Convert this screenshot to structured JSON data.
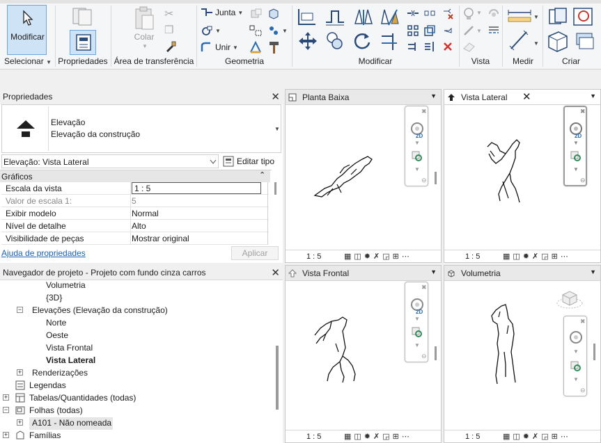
{
  "ribbon": {
    "selecionar": {
      "button_label": "Modificar",
      "group_label": "Selecionar"
    },
    "propriedades": {
      "group_label": "Propriedades"
    },
    "clipboard": {
      "colar_label": "Colar",
      "group_label": "Área de transferência"
    },
    "geometria": {
      "junta_label": "Junta",
      "unir_label": "Unir",
      "group_label": "Geometria"
    },
    "modificar": {
      "group_label": "Modificar"
    },
    "vista": {
      "group_label": "Vista"
    },
    "medir": {
      "group_label": "Medir"
    },
    "criar": {
      "group_label": "Criar"
    }
  },
  "properties": {
    "title": "Propriedades",
    "type_line1": "Elevação",
    "type_line2": "Elevação da construção",
    "selector_value": "Elevação: Vista Lateral",
    "edit_type_label": "Editar tipo",
    "section_label": "Gráficos",
    "rows": [
      {
        "key": "Escala da vista",
        "value": "1 : 5"
      },
      {
        "key": "Valor de escala    1:",
        "value": "5"
      },
      {
        "key": "Exibir modelo",
        "value": "Normal"
      },
      {
        "key": "Nível de detalhe",
        "value": "Alto"
      },
      {
        "key": "Visibilidade de peças",
        "value": "Mostrar original"
      }
    ],
    "help_link": "Ajuda de propriedades",
    "apply_label": "Aplicar"
  },
  "browser": {
    "title": "Navegador de projeto - Projeto com fundo cinza carros",
    "items": [
      {
        "label": "Volumetria"
      },
      {
        "label": "{3D}"
      },
      {
        "label": "Elevações (Elevação da construção)"
      },
      {
        "label": "Norte"
      },
      {
        "label": "Oeste"
      },
      {
        "label": "Vista Frontal"
      },
      {
        "label": "Vista Lateral"
      },
      {
        "label": "Renderizações"
      },
      {
        "label": "Legendas"
      },
      {
        "label": "Tabelas/Quantidades (todas)"
      },
      {
        "label": "Folhas (todas)"
      },
      {
        "label": "A101 - Não nomeada"
      },
      {
        "label": "Famílias"
      }
    ]
  },
  "views": [
    {
      "title": "Planta Baixa",
      "scale": "1 : 5"
    },
    {
      "title": "Vista Lateral",
      "scale": "1 : 5"
    },
    {
      "title": "Vista Frontal",
      "scale": "1 : 5"
    },
    {
      "title": "Volumetria",
      "scale": "1 : 5"
    }
  ],
  "nav_badge": "2D",
  "colors": {
    "accent": "#2b6cb0",
    "selected_bg": "#cfe3f7",
    "link": "#1a5fb4"
  }
}
